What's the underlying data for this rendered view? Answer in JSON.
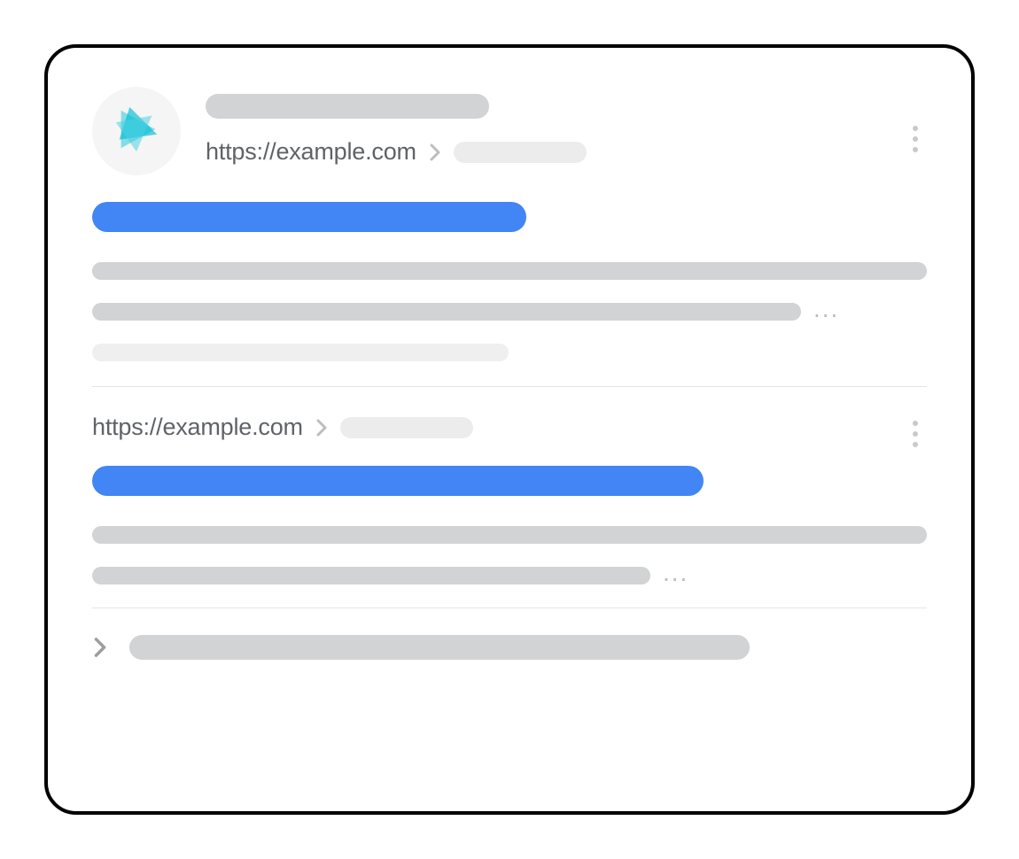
{
  "result1": {
    "url": "https://example.com"
  },
  "result2": {
    "url": "https://example.com"
  },
  "colors": {
    "link_blue": "#4285f4",
    "placeholder_gray": "#d1d3d4",
    "placeholder_light": "#efefef",
    "text_gray": "#5f6368",
    "favicon_teal": "#26c6da"
  },
  "glyphs": {
    "ellipsis": "..."
  }
}
